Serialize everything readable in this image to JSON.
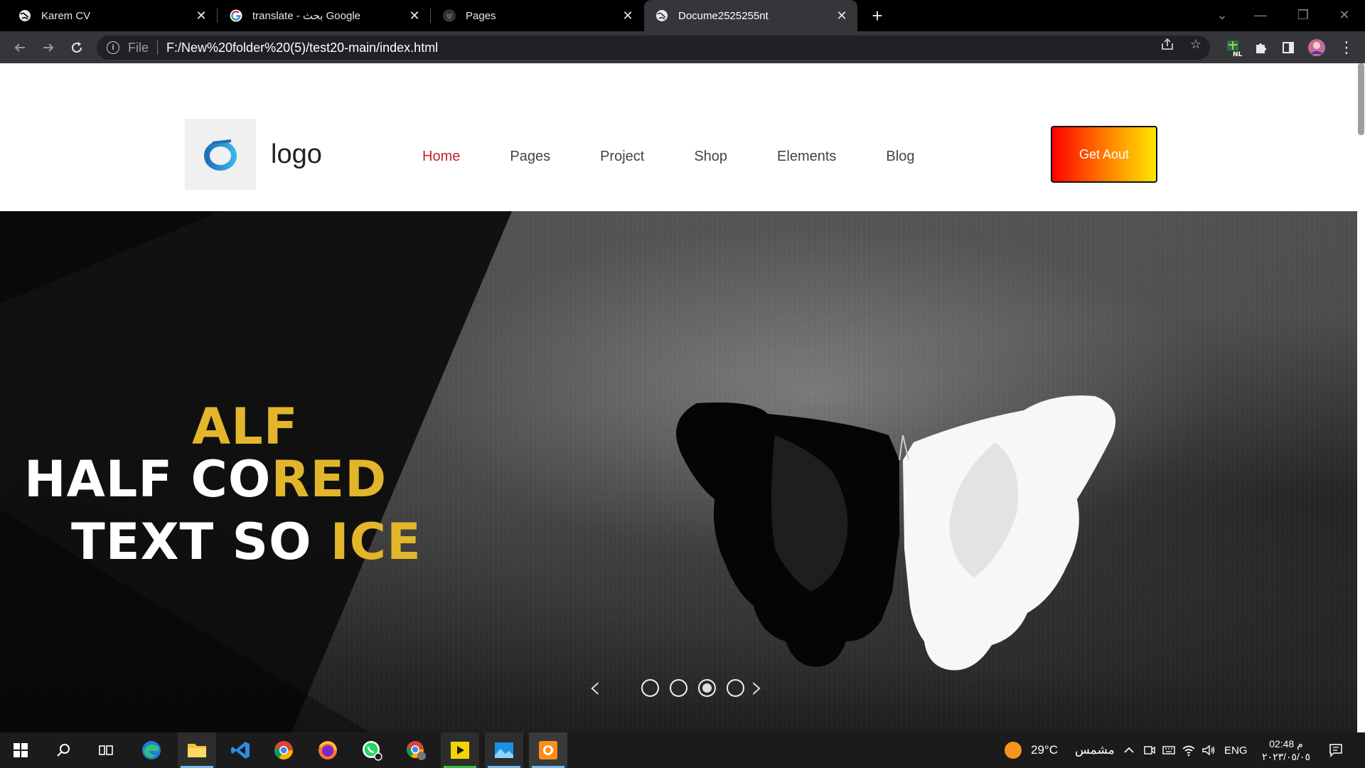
{
  "browser": {
    "tabs": [
      {
        "title": "Karem CV",
        "active": false
      },
      {
        "title": "translate - بحث Google",
        "active": false
      },
      {
        "title": "Pages",
        "active": false
      },
      {
        "title": "Docume2525255nt",
        "active": true
      }
    ],
    "omnibox": {
      "scheme_label": "File",
      "url": "F:/New%20folder%20(5)/test20-main/index.html"
    },
    "profile_badge": "NL"
  },
  "site": {
    "logo_text": "logo",
    "nav": [
      {
        "label": "Home",
        "active": true
      },
      {
        "label": "Pages",
        "active": false
      },
      {
        "label": "Project",
        "active": false
      },
      {
        "label": "Shop",
        "active": false
      },
      {
        "label": "Elements",
        "active": false
      },
      {
        "label": "Blog",
        "active": false
      }
    ],
    "cta_label": "Get Aout",
    "accent_color": "#c0262d",
    "hero": {
      "lines": [
        {
          "white": "",
          "gold": "ALF"
        },
        {
          "white": "HALF CO",
          "gold": "RED"
        },
        {
          "white": "TEXT SO",
          "gold": "ICE"
        }
      ],
      "gold_color": "#e2b52b",
      "slides_count": 4,
      "active_slide": 3
    }
  },
  "taskbar": {
    "weather_temp": "29°C",
    "weather_label": "مشمس",
    "language": "ENG",
    "time": "02:48 م",
    "date": "٢٠٢٣/٠٥/٠٥"
  }
}
